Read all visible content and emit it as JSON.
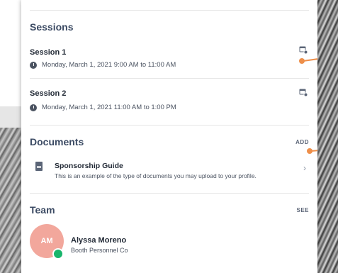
{
  "sessions": {
    "title": "Sessions",
    "items": [
      {
        "title": "Session 1",
        "time": "Monday, March 1, 2021 9:00 AM to 11:00 AM"
      },
      {
        "title": "Session 2",
        "time": "Monday, March 1, 2021 11:00 AM to 1:00 PM"
      }
    ]
  },
  "documents": {
    "title": "Documents",
    "action": "ADD",
    "items": [
      {
        "title": "Sponsorship Guide",
        "description": "This is an example of the type of documents you may upload to your profile."
      }
    ]
  },
  "team": {
    "title": "Team",
    "action": "SEE",
    "members": [
      {
        "initials": "AM",
        "name": "Alyssa Moreno",
        "org": "Booth Personnel Co"
      }
    ]
  },
  "colors": {
    "heading": "#3b4a63",
    "avatar": "#f2a79c",
    "online": "#18b56b",
    "hotspot": "#ee8f4a"
  }
}
